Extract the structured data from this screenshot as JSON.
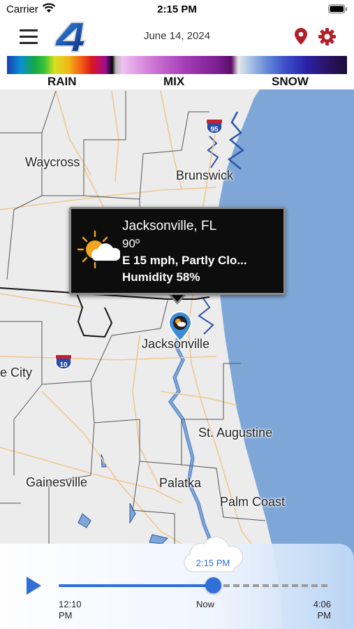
{
  "status_bar": {
    "carrier": "Carrier",
    "time": "2:15 PM"
  },
  "header": {
    "date": "June 14, 2024",
    "logo_text": "4",
    "icons": [
      "menu-icon",
      "location-pin-icon",
      "gear-icon"
    ],
    "accent_color": "#b3202a"
  },
  "legend": {
    "labels": [
      "RAIN",
      "MIX",
      "SNOW"
    ]
  },
  "map": {
    "labels": {
      "waycross": "Waycross",
      "brunswick": "Brunswick",
      "jacksonville": "Jacksonville",
      "lake_city": "e City",
      "st_augustine": "St. Augustine",
      "gainesville": "Gainesville",
      "palatka": "Palatka",
      "palm_coast": "Palm Coast"
    },
    "shields": {
      "i95": "95",
      "i10": "10"
    },
    "water_color": "#7ea7d8"
  },
  "popup": {
    "city": "Jacksonville, FL",
    "temperature": "90º",
    "wind_conditions": "E 15 mph,  Partly Clo...",
    "humidity": "Humidity 58%",
    "weather_icon": "partly-cloudy-icon"
  },
  "timeline": {
    "current_time": "2:15 PM",
    "start_time": "12:10",
    "start_period": "PM",
    "now_label": "Now",
    "end_time": "4:06",
    "end_period": "PM",
    "progress_fraction": 0.58,
    "accent_color": "#2f6fd8"
  }
}
